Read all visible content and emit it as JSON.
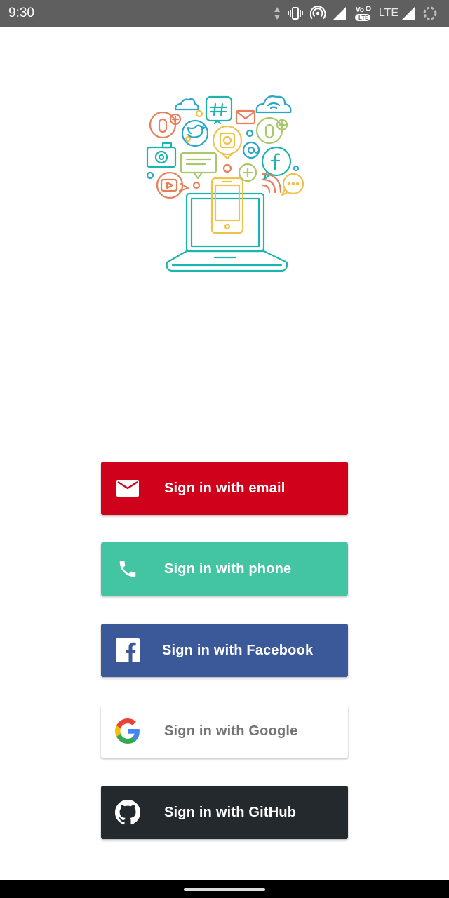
{
  "status_bar": {
    "time": "9:30",
    "network_label": "LTE",
    "icons": [
      "data-activity-icon",
      "vibrate-icon",
      "hotspot-icon",
      "signal-icon",
      "volte-icon",
      "lte-signal-icon",
      "battery-icon"
    ]
  },
  "illustration": {
    "icon": "social-media-laptop-illustration"
  },
  "buttons": {
    "email": {
      "label": "Sign in with email",
      "icon": "mail-icon",
      "color": "#d0021b"
    },
    "phone": {
      "label": "Sign in with phone",
      "icon": "phone-icon",
      "color": "#43c5a4"
    },
    "facebook": {
      "label": "Sign in with Facebook",
      "icon": "facebook-icon",
      "color": "#3b5998"
    },
    "google": {
      "label": "Sign in with Google",
      "icon": "google-icon",
      "color": "#ffffff"
    },
    "github": {
      "label": "Sign in with GitHub",
      "icon": "github-icon",
      "color": "#24292e"
    }
  },
  "nav_bar": {
    "icon": "home-pill"
  }
}
